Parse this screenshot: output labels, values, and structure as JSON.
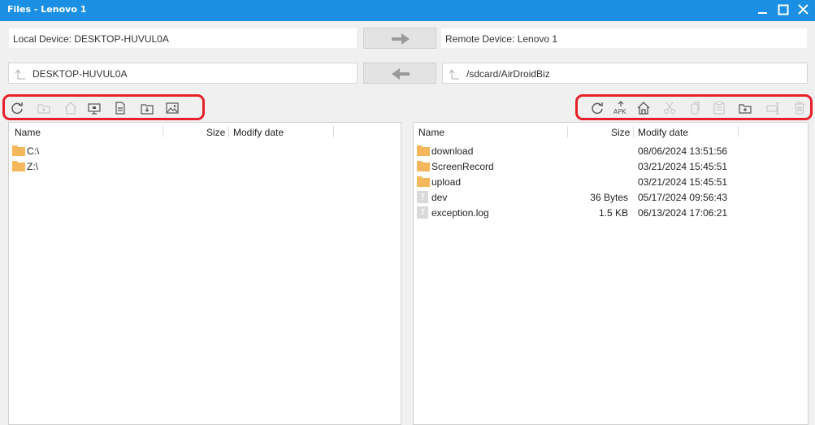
{
  "window": {
    "title": "Files - Lenovo 1"
  },
  "local": {
    "device_label": "Local Device: DESKTOP-HUVUL0A",
    "path": "DESKTOP-HUVUL0A",
    "columns": {
      "name": "Name",
      "size": "Size",
      "date": "Modify date"
    },
    "items": [
      {
        "name": "C:\\",
        "type": "folder"
      },
      {
        "name": "Z:\\",
        "type": "folder"
      }
    ],
    "toolbar_icons": [
      "refresh-icon",
      "new-folder-icon",
      "home-icon",
      "desktop-icon",
      "documents-icon",
      "downloads-icon",
      "pictures-icon"
    ]
  },
  "remote": {
    "device_label": "Remote Device: Lenovo 1",
    "path": "/sdcard/AirDroidBiz",
    "columns": {
      "name": "Name",
      "size": "Size",
      "date": "Modify date"
    },
    "items": [
      {
        "name": "download",
        "size": "",
        "date": "08/06/2024 13:51:56",
        "type": "folder"
      },
      {
        "name": "ScreenRecord",
        "size": "",
        "date": "03/21/2024 15:45:51",
        "type": "folder"
      },
      {
        "name": "upload",
        "size": "",
        "date": "03/21/2024 15:45:51",
        "type": "folder"
      },
      {
        "name": "dev",
        "size": "36 Bytes",
        "date": "05/17/2024 09:56:43",
        "type": "unknown"
      },
      {
        "name": "exception.log",
        "size": "1.5 KB",
        "date": "06/13/2024 17:06:21",
        "type": "unknown"
      }
    ],
    "toolbar_icons": [
      "refresh-icon",
      "apk-icon",
      "home-icon",
      "cut-icon",
      "copy-icon",
      "paste-icon",
      "new-folder-icon",
      "rename-icon",
      "delete-icon"
    ]
  },
  "icons": {
    "apk_text": "APK",
    "unknown_glyph": "?"
  },
  "colors": {
    "titlebar": "#1a8fe3",
    "highlight": "#e8202a",
    "folder": "#f5b75c",
    "disabled_icon": "#c9c9c9",
    "enabled_icon": "#555555"
  }
}
